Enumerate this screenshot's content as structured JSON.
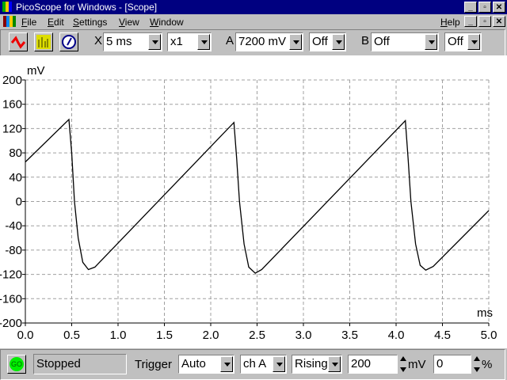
{
  "window": {
    "title": "PicoScope for Windows - [Scope]"
  },
  "menu": [
    "File",
    "Edit",
    "Settings",
    "View",
    "Window"
  ],
  "help": "Help",
  "toolbar": {
    "x_label": "X",
    "timebase": "5 ms",
    "multiplier": "x1",
    "a_label": "A",
    "a_range": "7200 mV",
    "a_coupling": "Off",
    "b_label": "B",
    "b_range": "Off",
    "b_coupling": "Off"
  },
  "status": {
    "go": "GO",
    "state": "Stopped",
    "trigger_label": "Trigger",
    "trigger_mode": "Auto",
    "trigger_channel": "ch A",
    "trigger_edge": "Rising",
    "trigger_level": "200",
    "level_unit": "mV",
    "delay": "0",
    "delay_unit": "%"
  },
  "chart_data": {
    "type": "line",
    "ylabel": "mV",
    "xlabel": "ms",
    "xlim": [
      0,
      5
    ],
    "ylim": [
      -200,
      200
    ],
    "grid": true,
    "xticks": [
      "0.0",
      "0.5",
      "1.0",
      "1.5",
      "2.0",
      "2.5",
      "3.0",
      "3.5",
      "4.0",
      "4.5",
      "5.0"
    ],
    "yticks": [
      "200",
      "160",
      "120",
      "80",
      "40",
      "0",
      "-40",
      "-80",
      "-120",
      "-160",
      "-200"
    ],
    "series": [
      {
        "name": "A",
        "color": "#000000",
        "x": [
          0,
          0.47,
          0.5,
          0.53,
          0.57,
          0.62,
          0.68,
          0.75,
          2.25,
          2.28,
          2.31,
          2.36,
          2.41,
          2.48,
          2.55,
          4.1,
          4.13,
          4.16,
          4.21,
          4.26,
          4.32,
          4.4,
          5.0
        ],
        "y": [
          65,
          135,
          80,
          0,
          -60,
          -100,
          -112,
          -108,
          130,
          70,
          0,
          -70,
          -108,
          -118,
          -112,
          133,
          70,
          0,
          -70,
          -105,
          -113,
          -107,
          -15
        ]
      }
    ]
  }
}
